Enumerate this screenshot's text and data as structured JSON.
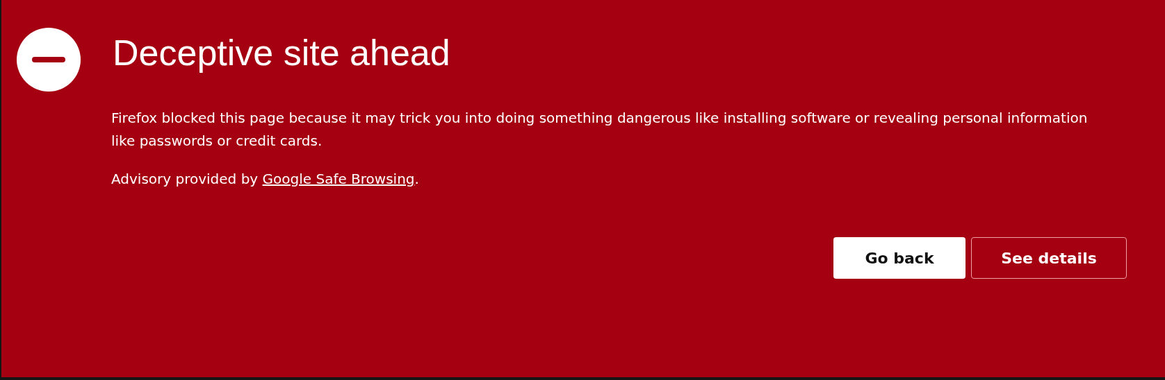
{
  "title": "Deceptive site ahead",
  "description": "Firefox blocked this page because it may trick you into doing something dangerous like installing software or revealing personal information like passwords or credit cards.",
  "advisory": {
    "prefix": "Advisory provided by ",
    "link": "Google Safe Browsing",
    "suffix": "."
  },
  "buttons": [
    {
      "label": "Go back",
      "kind": "primary"
    },
    {
      "label": "See details",
      "kind": "secondary"
    }
  ]
}
